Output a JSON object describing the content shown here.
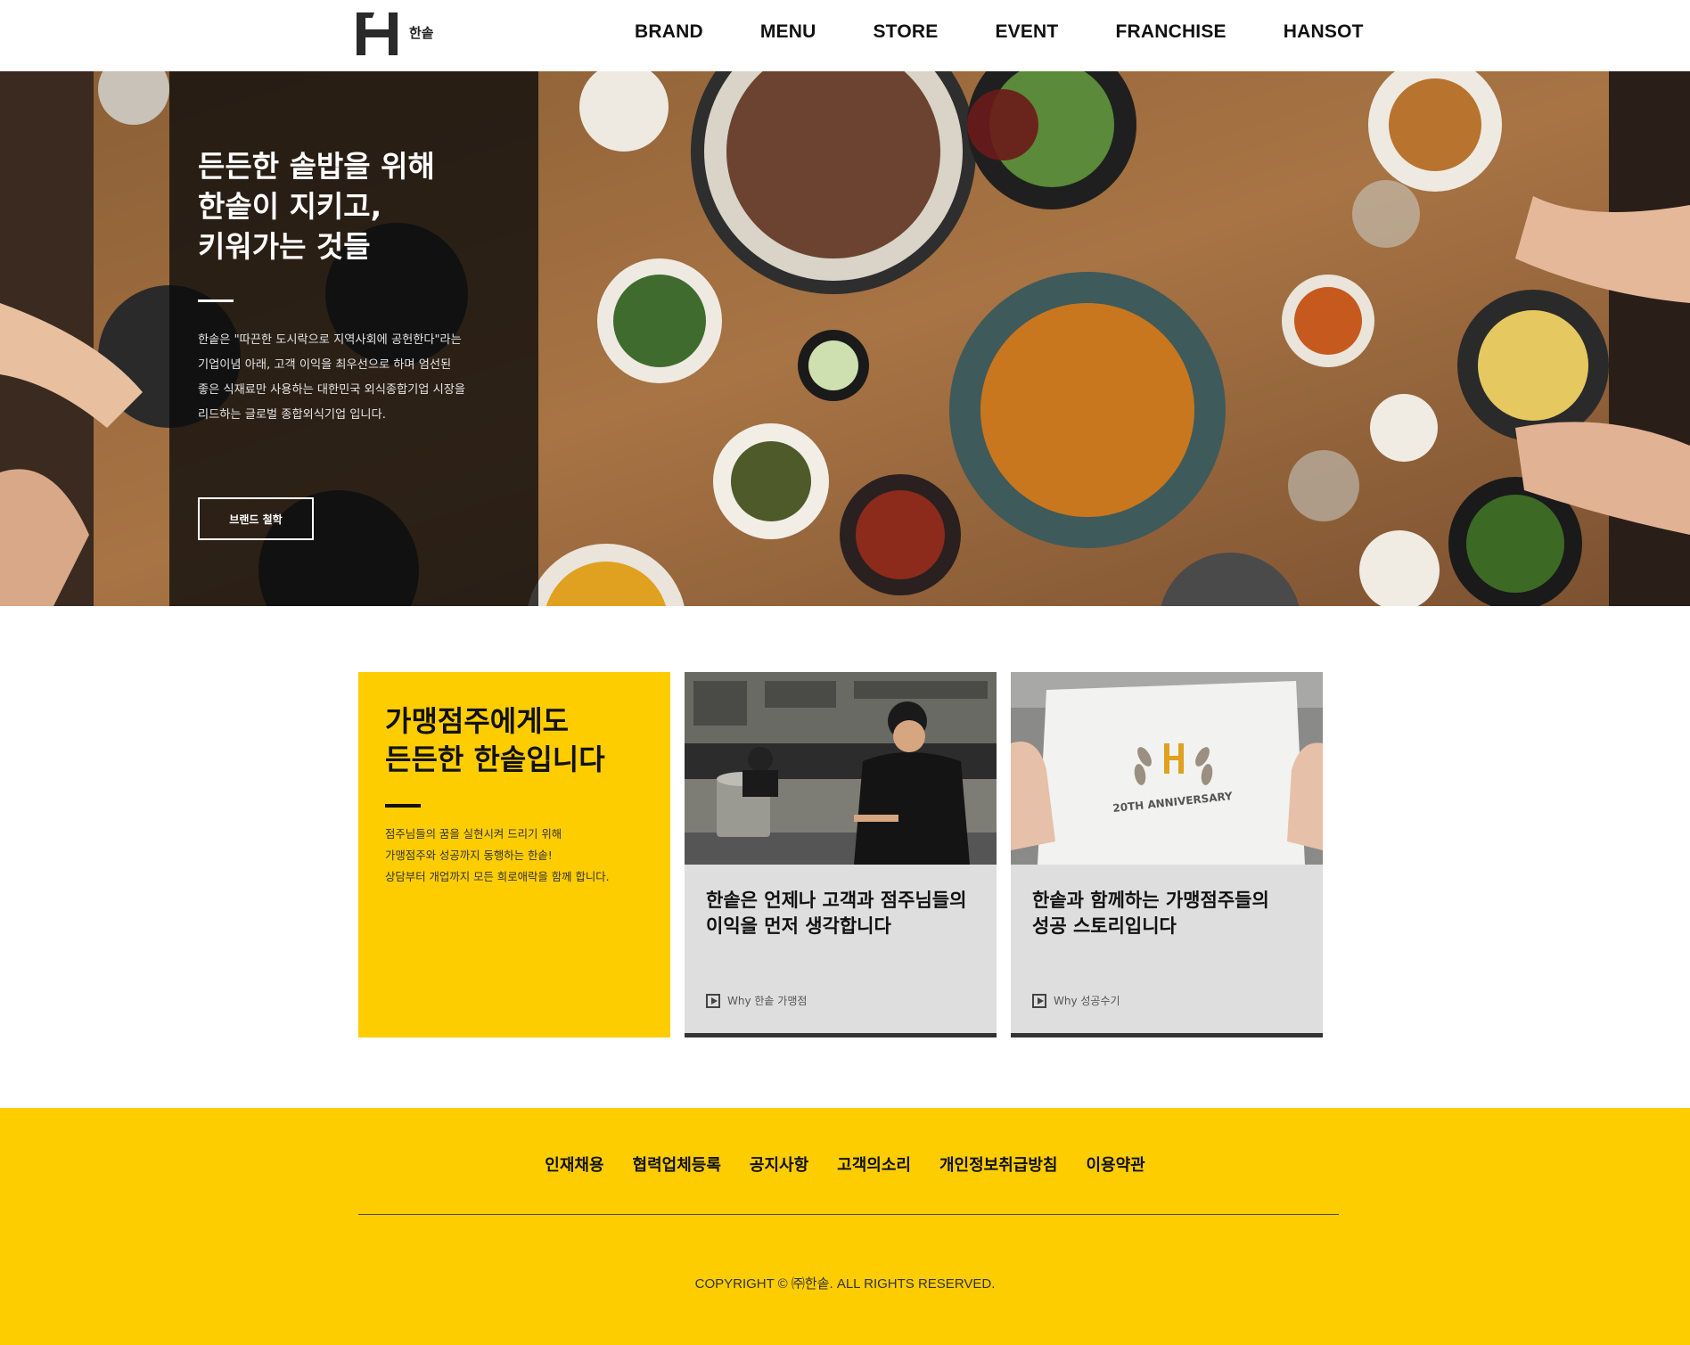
{
  "header": {
    "logo_text": "한솥",
    "nav": [
      "BRAND",
      "MENU",
      "STORE",
      "EVENT",
      "FRANCHISE",
      "HANSOT"
    ]
  },
  "hero": {
    "title": "든든한 솥밥을 위해\n한솥이 지키고,\n키워가는 것들",
    "description": "한솥은 \"따끈한 도시락으로 지역사회에 공헌한다\"라는\n기업이념 아래, 고객 이익을 최우선으로 하며 엄선된\n좋은 식재료만 사용하는 대한민국 외식종합기업 시장을\n리드하는 글로벌 종합외식기업 입니다.",
    "button_label": "브랜드 철학"
  },
  "franchise": {
    "title": "가맹점주에게도\n든든한 한솥입니다",
    "description": "점주님들의 꿈을 실현시켜 드리기 위해\n가맹점주와 성공까지 동행하는 한솥!\n상담부터 개업까지 모든 희로애락을 함께 합니다."
  },
  "cards": [
    {
      "text": "한솥은 언제나 고객과 점주님들의\n이익을 먼저 생각합니다",
      "link": "Why 한솥 가맹점"
    },
    {
      "text": "한솥과 함께하는 가맹점주들의\n성공 스토리입니다",
      "link": "Why 성공수기",
      "image_caption": "20TH ANNIVERSARY"
    }
  ],
  "footer": {
    "links": [
      "인재채용",
      "협력업체등록",
      "공지사항",
      "고객의소리",
      "개인정보취급방침",
      "이용약관"
    ],
    "copyright": "COPYRIGHT © ㈜한솥. ALL RIGHTS RESERVED."
  },
  "colors": {
    "accent": "#fecd00",
    "dark": "#111111"
  }
}
